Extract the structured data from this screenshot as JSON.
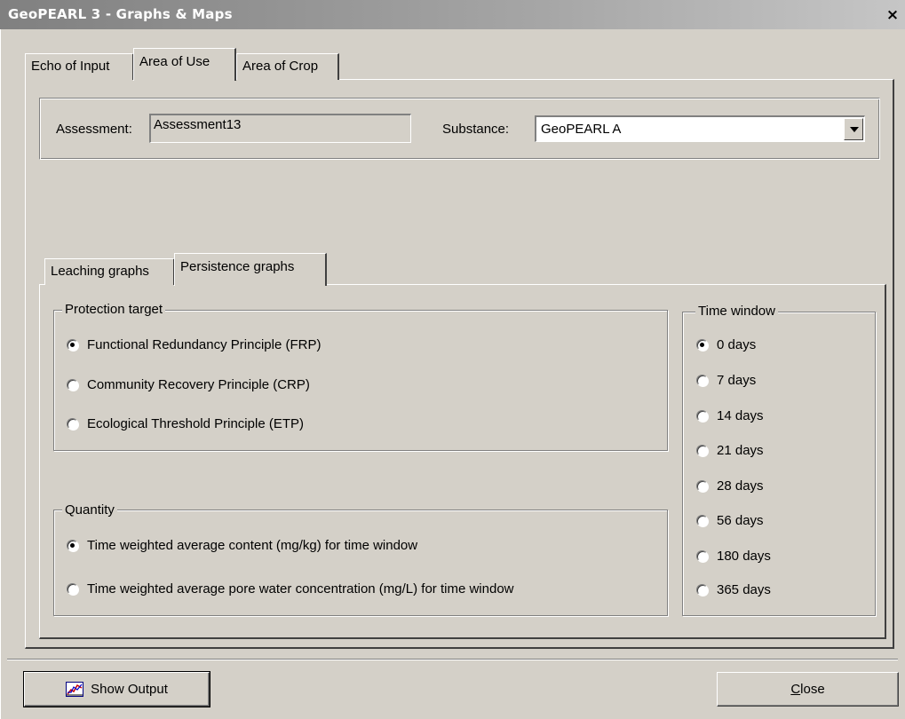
{
  "window": {
    "title": "GeoPEARL 3 - Graphs & Maps",
    "close_glyph": "×"
  },
  "tabs_outer": [
    {
      "label": "Echo of Input",
      "active": false
    },
    {
      "label": "Area of Use",
      "active": true
    },
    {
      "label": "Area of Crop",
      "active": false
    }
  ],
  "assessment": {
    "label": "Assessment:",
    "value": "Assessment13"
  },
  "substance": {
    "label": "Substance:",
    "value": "GeoPEARL A"
  },
  "tabs_inner": [
    {
      "label": "Leaching graphs",
      "active": false
    },
    {
      "label": "Persistence graphs",
      "active": true
    }
  ],
  "protection_target": {
    "title": "Protection target",
    "options": [
      {
        "label": "Functional Redundancy Principle (FRP)",
        "checked": true
      },
      {
        "label": "Community Recovery Principle (CRP)",
        "checked": false
      },
      {
        "label": "Ecological Threshold Principle (ETP)",
        "checked": false
      }
    ]
  },
  "quantity": {
    "title": "Quantity",
    "options": [
      {
        "label": "Time weighted average content (mg/kg) for time window",
        "checked": true
      },
      {
        "label": "Time weighted average pore water concentration (mg/L) for time window",
        "checked": false
      }
    ]
  },
  "time_window": {
    "title": "Time window",
    "options": [
      {
        "label": "0 days",
        "checked": true
      },
      {
        "label": "7 days",
        "checked": false
      },
      {
        "label": "14 days",
        "checked": false
      },
      {
        "label": "21 days",
        "checked": false
      },
      {
        "label": "28 days",
        "checked": false
      },
      {
        "label": "56 days",
        "checked": false
      },
      {
        "label": "180 days",
        "checked": false
      },
      {
        "label": "365 days",
        "checked": false
      }
    ]
  },
  "buttons": {
    "show_output": "Show Output",
    "close_underlined": "C",
    "close_rest": "lose"
  },
  "colors": {
    "face": "#d4d0c8",
    "shadow": "#808080",
    "highlight": "#ffffff",
    "title_gradient_start": "#808080"
  },
  "icons": {
    "show_output": "chart-icon",
    "substance_dropdown": "dropdown-arrow-icon"
  }
}
